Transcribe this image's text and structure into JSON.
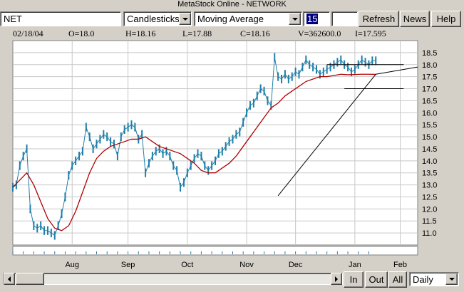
{
  "app": {
    "title": "MetaStock Online - NETWORK"
  },
  "toolbar": {
    "symbol": "NET",
    "chart_style": "Candlesticks",
    "indicator": "Moving Average",
    "period": "15",
    "extra": "",
    "refresh_label": "Refresh",
    "news_label": "News",
    "help_label": "Help"
  },
  "info": {
    "date": "02/18/04",
    "open": "O=18.0",
    "high": "H=18.16",
    "low": "L=17.88",
    "close": "C=18.16",
    "volume": "V=362600.0",
    "indicator": "I=17.595"
  },
  "bottom": {
    "in_label": "In",
    "out_label": "Out",
    "all_label": "All",
    "interval": "Daily"
  },
  "colors": {
    "price": "#1f7faa",
    "ma": "#b00000",
    "trend": "#000000",
    "grid": "#c8c8c8"
  },
  "chart_data": {
    "type": "line",
    "title": "",
    "xlabel": "",
    "ylabel": "",
    "ylim": [
      10.5,
      19.0
    ],
    "yticks": [
      "11.0",
      "11.5",
      "12.0",
      "12.5",
      "13.0",
      "13.5",
      "14.0",
      "14.5",
      "15.0",
      "15.5",
      "16.0",
      "16.5",
      "17.0",
      "17.5",
      "18.0",
      "18.5"
    ],
    "xticks": [
      "Aug",
      "Sep",
      "Oct",
      "Nov",
      "Dec",
      "Jan",
      "Feb"
    ],
    "grid": true,
    "series": [
      {
        "role": "price",
        "x": [
          0,
          2,
          4,
          6,
          8,
          10,
          12,
          14,
          16,
          18,
          20,
          22,
          24,
          26,
          28,
          30,
          32,
          34,
          36,
          38,
          40,
          42,
          44,
          46,
          48,
          50,
          52,
          54,
          56,
          58,
          60,
          62,
          64,
          66,
          68,
          70,
          72,
          74,
          76,
          78,
          80,
          82,
          84,
          86,
          88,
          90,
          92,
          94,
          96,
          98,
          100,
          102,
          104,
          106,
          108,
          110,
          112,
          114,
          116,
          118,
          120,
          122,
          124,
          126,
          128,
          130,
          132,
          134,
          136,
          138,
          140,
          142,
          144,
          146,
          148,
          150,
          152,
          154,
          156,
          158,
          160,
          162,
          164,
          166,
          168,
          170,
          172,
          174,
          176,
          178,
          180,
          182,
          184,
          186,
          188,
          190,
          192,
          194,
          196,
          198,
          200,
          202,
          204,
          206,
          208
        ],
        "y": [
          12.9,
          13.0,
          13.8,
          14.2,
          14.5,
          12.0,
          11.3,
          11.2,
          11.3,
          11.1,
          11.1,
          11.0,
          10.9,
          11.3,
          11.8,
          12.5,
          13.4,
          13.8,
          14.0,
          14.2,
          14.4,
          15.4,
          15.0,
          14.5,
          14.7,
          14.9,
          15.1,
          15.0,
          14.8,
          14.7,
          14.2,
          15.0,
          15.3,
          15.4,
          15.5,
          15.4,
          14.9,
          15.1,
          13.5,
          13.9,
          14.2,
          14.4,
          14.5,
          14.3,
          14.4,
          14.2,
          13.8,
          13.6,
          12.9,
          13.1,
          13.5,
          13.8,
          14.1,
          14.3,
          14.2,
          13.8,
          13.6,
          13.8,
          14.0,
          14.3,
          14.4,
          14.6,
          14.8,
          14.9,
          15.1,
          15.2,
          15.6,
          16.0,
          16.3,
          16.4,
          16.7,
          17.0,
          16.9,
          16.5,
          16.3,
          18.3,
          17.5,
          17.4,
          17.6,
          17.4,
          17.5,
          17.7,
          17.6,
          17.9,
          18.2,
          18.0,
          17.9,
          17.8,
          17.6,
          17.7,
          17.8,
          17.9,
          18.0,
          18.1,
          18.2,
          18.0,
          17.9,
          17.7,
          17.8,
          18.0,
          18.2,
          18.1,
          18.0,
          18.16,
          18.16
        ]
      },
      {
        "role": "moving-average",
        "x": [
          0,
          4,
          8,
          12,
          16,
          20,
          24,
          28,
          32,
          36,
          40,
          44,
          48,
          52,
          56,
          60,
          64,
          68,
          72,
          76,
          80,
          84,
          88,
          92,
          96,
          100,
          104,
          108,
          112,
          116,
          120,
          124,
          128,
          132,
          136,
          140,
          144,
          148,
          152,
          156,
          160,
          164,
          168,
          172,
          176,
          180,
          184,
          188,
          192,
          196,
          200,
          204,
          208
        ],
        "y": [
          12.9,
          13.2,
          13.5,
          13.0,
          12.3,
          11.6,
          11.2,
          11.1,
          11.3,
          11.9,
          12.7,
          13.5,
          14.1,
          14.4,
          14.6,
          14.7,
          14.8,
          14.9,
          14.9,
          15.0,
          14.8,
          14.6,
          14.5,
          14.4,
          14.3,
          14.1,
          13.9,
          13.6,
          13.5,
          13.5,
          13.7,
          13.9,
          14.2,
          14.6,
          15.0,
          15.4,
          15.8,
          16.2,
          16.4,
          16.7,
          16.9,
          17.1,
          17.3,
          17.4,
          17.5,
          17.5,
          17.55,
          17.6,
          17.58,
          17.59,
          17.6,
          17.6,
          17.595
        ]
      }
    ],
    "annotations": [
      {
        "type": "trendline",
        "x": [
          152,
          208
        ],
        "y": [
          12.55,
          17.6
        ]
      },
      {
        "type": "trendline",
        "x": [
          208,
          232
        ],
        "y": [
          17.6,
          17.9
        ]
      },
      {
        "type": "hline",
        "y": 18.0,
        "x": [
          180,
          224
        ]
      },
      {
        "type": "hline",
        "y": 17.0,
        "x": [
          190,
          224
        ]
      }
    ],
    "x_range": [
      0,
      232
    ],
    "xtick_x": [
      34,
      66,
      100,
      134,
      162,
      196,
      222
    ]
  }
}
